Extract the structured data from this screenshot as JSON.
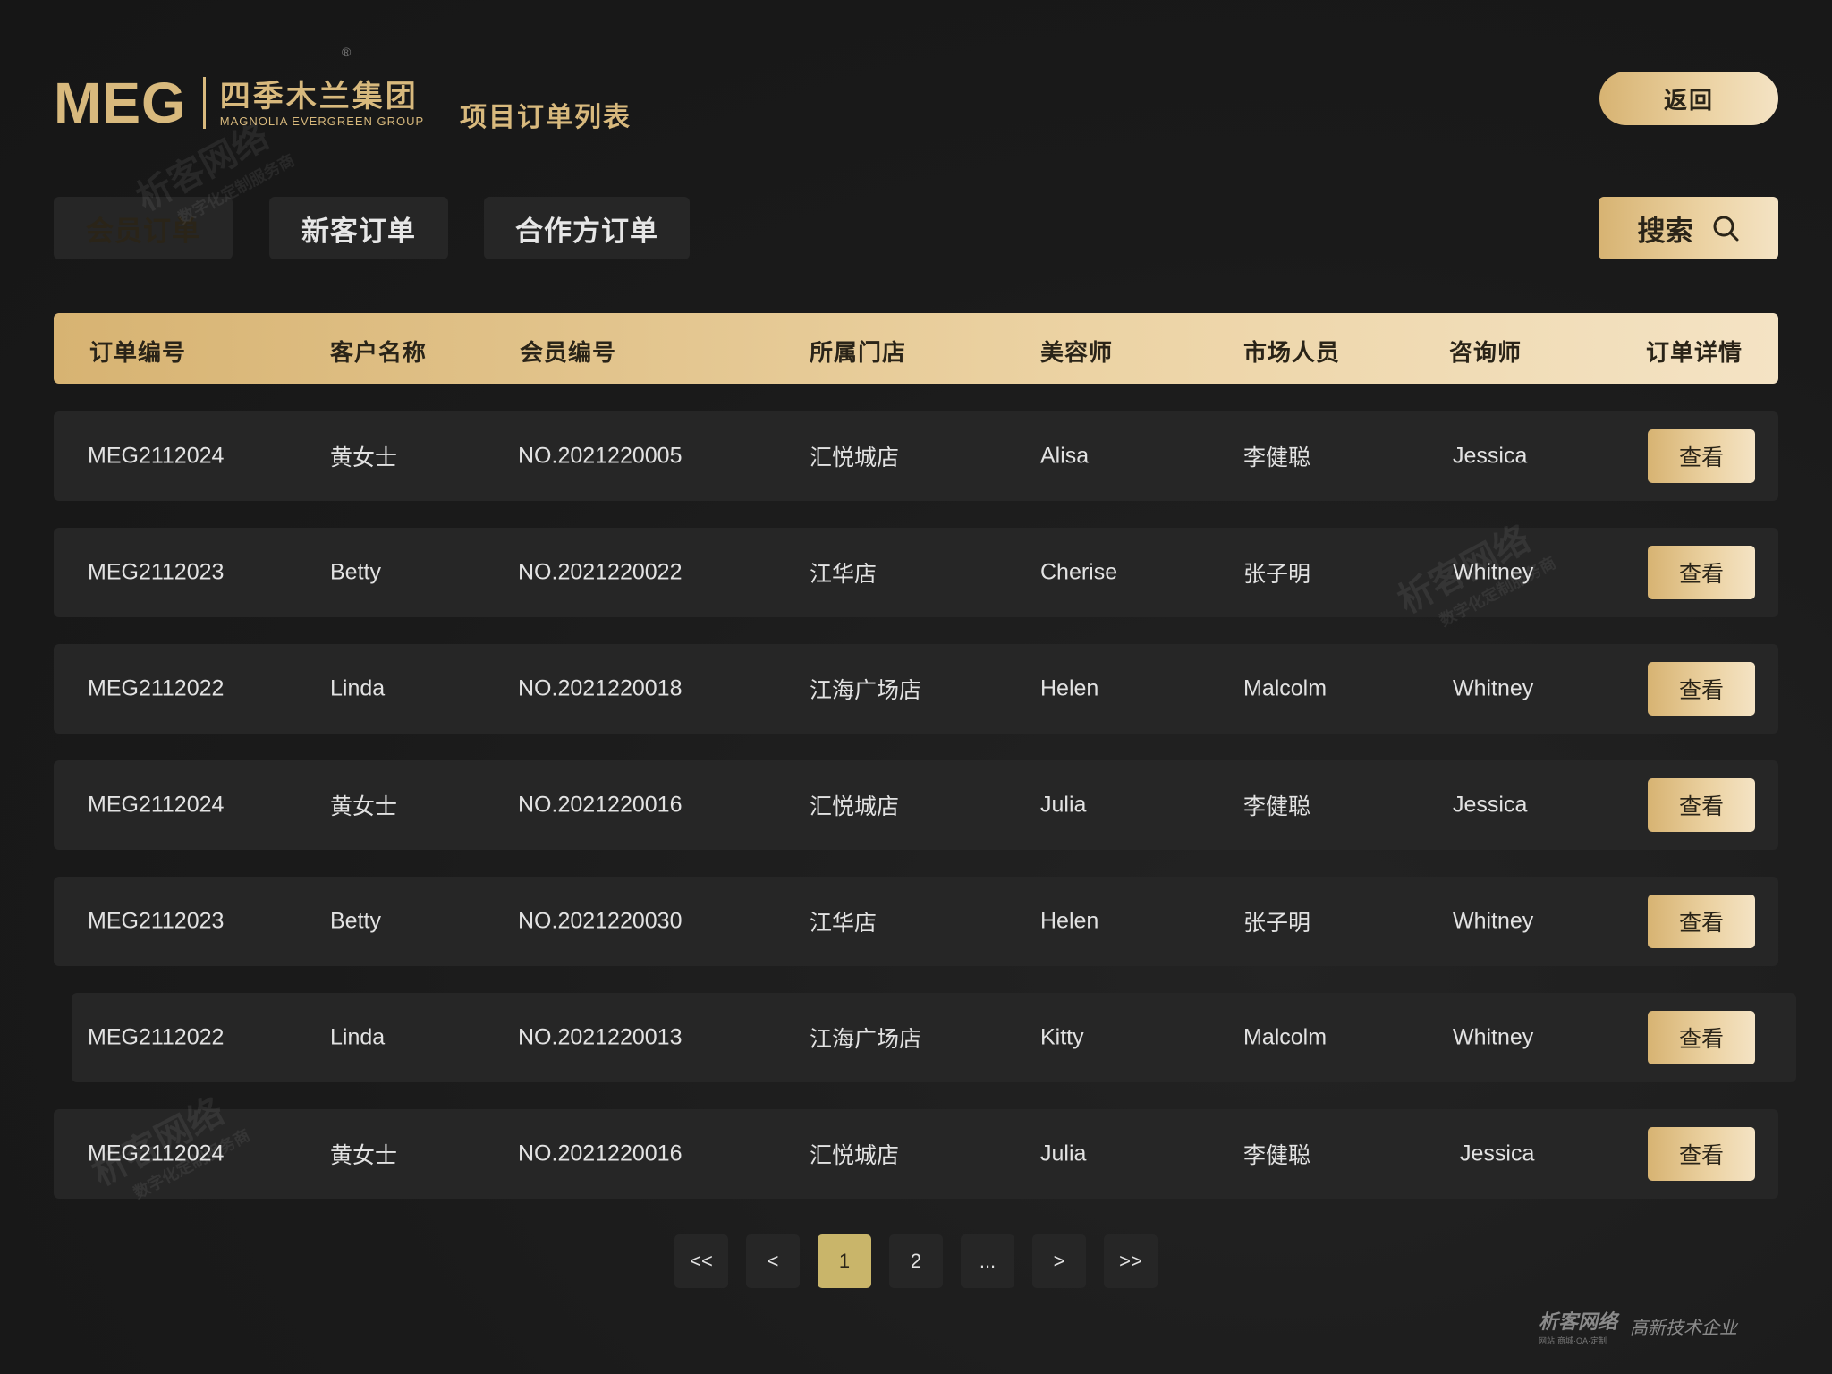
{
  "header": {
    "logo_meg": "MEG",
    "logo_cn": "四季木兰集团",
    "logo_en": "MAGNOLIA EVERGREEN GROUP",
    "logo_reg": "®",
    "page_title": "项目订单列表",
    "back_label": "返回"
  },
  "tabs": [
    {
      "label": "会员订单",
      "active": true
    },
    {
      "label": "新客订单",
      "active": false
    },
    {
      "label": "合作方订单",
      "active": false
    }
  ],
  "search": {
    "label": "搜索",
    "icon": "search-icon"
  },
  "table": {
    "columns": [
      "订单编号",
      "客户名称",
      "会员编号",
      "所属门店",
      "美容师",
      "市场人员",
      "咨询师",
      "订单详情"
    ],
    "view_label": "查看",
    "rows": [
      {
        "order_no": "MEG2112024",
        "customer": "黄女士",
        "member_no": "NO.2021220005",
        "store": "汇悦城店",
        "beautician": "Alisa",
        "marketer": "李健聪",
        "consultant": "Jessica"
      },
      {
        "order_no": "MEG2112023",
        "customer": "Betty",
        "member_no": "NO.2021220022",
        "store": "江华店",
        "beautician": "Cherise",
        "marketer": "张子明",
        "consultant": "Whitney"
      },
      {
        "order_no": "MEG2112022",
        "customer": "Linda",
        "member_no": "NO.2021220018",
        "store": "江海广场店",
        "beautician": "Helen",
        "marketer": "Malcolm",
        "consultant": "Whitney"
      },
      {
        "order_no": "MEG2112024",
        "customer": "黄女士",
        "member_no": "NO.2021220016",
        "store": "汇悦城店",
        "beautician": "Julia",
        "marketer": "李健聪",
        "consultant": "Jessica"
      },
      {
        "order_no": "MEG2112023",
        "customer": "Betty",
        "member_no": "NO.2021220030",
        "store": "江华店",
        "beautician": "Helen",
        "marketer": "张子明",
        "consultant": "Whitney"
      },
      {
        "order_no": "MEG2112022",
        "customer": "Linda",
        "member_no": "NO.2021220013",
        "store": "江海广场店",
        "beautician": "Kitty",
        "marketer": "Malcolm",
        "consultant": "Whitney"
      },
      {
        "order_no": "MEG2112024",
        "customer": "黄女士",
        "member_no": "NO.2021220016",
        "store": "汇悦城店",
        "beautician": "Julia",
        "marketer": "李健聪",
        "consultant": "Jessica"
      }
    ]
  },
  "pagination": {
    "first": "<<",
    "prev": "<",
    "pages": [
      "1",
      "2",
      "..."
    ],
    "current": "1",
    "next": ">",
    "last": ">>"
  },
  "watermark": {
    "brand": "析客网络",
    "tagline": "数字化定制服务商",
    "footer_sub": "网站·商城·OA·定制",
    "footer_slogan": "高新技术企业"
  },
  "colors": {
    "background": "#1a1a1a",
    "row_bg": "#262626",
    "gold_start": "#d7b372",
    "gold_end": "#f4e3c4",
    "pager_active": "#c9b56a"
  }
}
